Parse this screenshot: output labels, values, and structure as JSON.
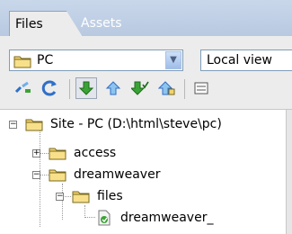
{
  "tabs": [
    {
      "label": "Files",
      "active": true
    },
    {
      "label": "Assets",
      "active": false
    }
  ],
  "site_select": {
    "value": "PC",
    "icon": "folder-icon"
  },
  "view_select": {
    "value": "Local view"
  },
  "toolbar_icons": [
    "connect-icon",
    "refresh-icon",
    "get-files-icon",
    "put-files-icon",
    "check-out-icon",
    "check-in-icon",
    "expand-icon"
  ],
  "tree": {
    "root": {
      "label": "Site - PC (D:\\html\\steve\\pc)",
      "expanded": true
    },
    "items": [
      {
        "label": "access",
        "type": "folder",
        "expanded": false
      },
      {
        "label": "dreamweaver",
        "type": "folder",
        "expanded": true
      },
      {
        "label": "files",
        "type": "folder",
        "expanded": true
      },
      {
        "label": "dreamweaver_",
        "type": "file"
      }
    ]
  },
  "colors": {
    "accent": "#b7c8e0",
    "folder": "#f3d36b",
    "arrow_green": "#3aa335",
    "arrow_blue": "#2f6fc7"
  }
}
